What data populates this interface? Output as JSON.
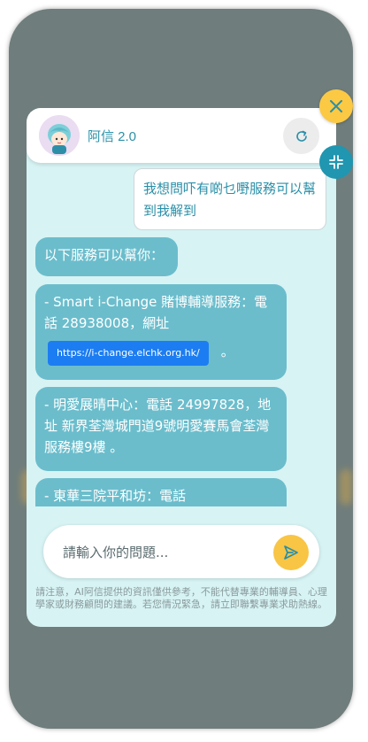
{
  "chat": {
    "title": "阿信 2.0",
    "input_placeholder": "請輸入你的問題...",
    "disclaimer": "請注意，AI阿信提供的資訊僅供參考，不能代替專業的輔導員、心理學家或財務顧問的建議。若您情況緊急，請立即聯繫專業求助熱線。"
  },
  "messages": {
    "user_1": "我想問吓有啲乜嘢服務可以幫到我解到",
    "bot_1": "以下服務可以幫你：",
    "bot_2": "- Smart i-Change 賭博輔導服務：電話 28938008，網址",
    "bot_2_link": "https://i-change.elchk.org.hk/",
    "bot_2_end": "。",
    "bot_3": "- 明愛展晴中心：電話 24997828，地址 新界荃灣城門道9號明愛賽馬會荃灣服務樓9樓 。",
    "bot_4": "- 東華三院平和坊：電話"
  },
  "icons": {
    "close": "close-icon",
    "shrink": "shrink-icon",
    "refresh": "refresh-icon",
    "send": "send-icon"
  },
  "colors": {
    "panel_bg": "#d7f3f4",
    "bot_bubble": "#6bbdcc",
    "accent_teal": "#2096b0",
    "accent_yellow": "#fbc944",
    "link_blue": "#1c7df2"
  }
}
